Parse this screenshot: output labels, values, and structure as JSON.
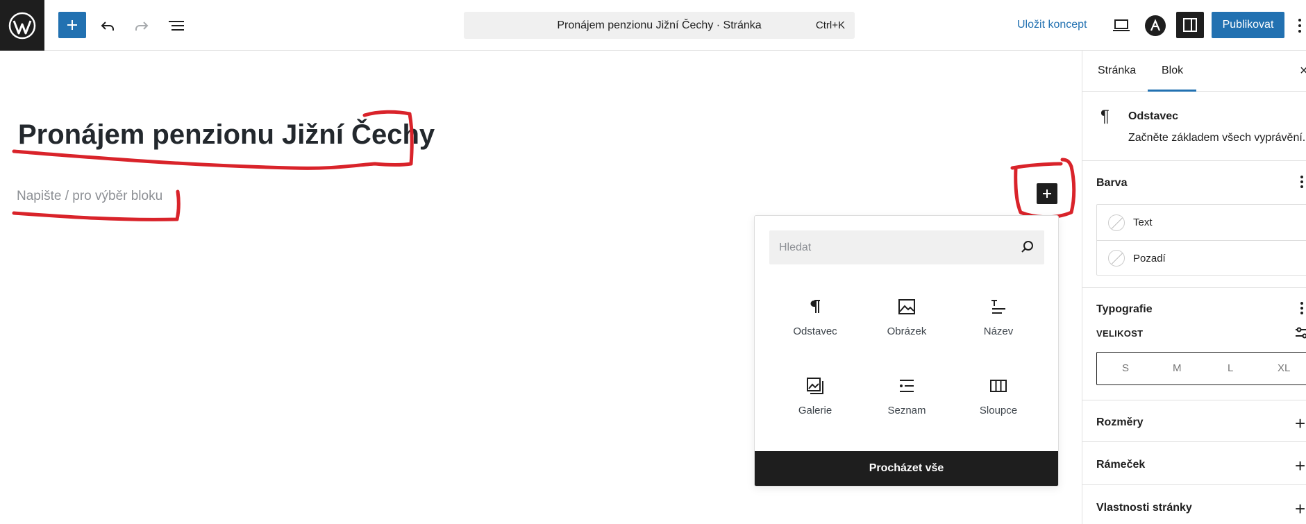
{
  "topbar": {
    "add_block_label": "+",
    "document_title": "Pronájem penzionu Jižní Čechy · Stránka",
    "command_shortcut": "Ctrl+K",
    "save_draft": "Uložit koncept",
    "publish": "Publikovat"
  },
  "editor": {
    "post_title": "Pronájem penzionu Jižní Čechy",
    "block_placeholder": "Napište / pro výběr bloku"
  },
  "inserter": {
    "search_placeholder": "Hledat",
    "blocks": [
      {
        "label": "Odstavec",
        "icon": "paragraph-icon"
      },
      {
        "label": "Obrázek",
        "icon": "image-icon"
      },
      {
        "label": "Název",
        "icon": "heading-icon"
      },
      {
        "label": "Galerie",
        "icon": "gallery-icon"
      },
      {
        "label": "Seznam",
        "icon": "list-icon"
      },
      {
        "label": "Sloupce",
        "icon": "columns-icon"
      }
    ],
    "browse_all": "Procházet vše"
  },
  "sidebar": {
    "tabs": [
      "Stránka",
      "Blok"
    ],
    "active_tab": "Blok",
    "close_glyph": "×",
    "block_card": {
      "icon_glyph": "¶",
      "title": "Odstavec",
      "description": "Začněte základem všech vyprávění."
    },
    "color_panel": {
      "title": "Barva",
      "items": [
        "Text",
        "Pozadí"
      ]
    },
    "typography_panel": {
      "title": "Typografie",
      "size_label": "VELIKOST",
      "sizes": [
        "S",
        "M",
        "L",
        "XL"
      ]
    },
    "collapsed_panels": [
      "Rozměry",
      "Rámeček",
      "Vlastnosti stránky"
    ],
    "plus_glyph": "+"
  },
  "colors": {
    "accent": "#2271b1",
    "dark": "#1e1e1e",
    "annotation": "#d9232a"
  }
}
